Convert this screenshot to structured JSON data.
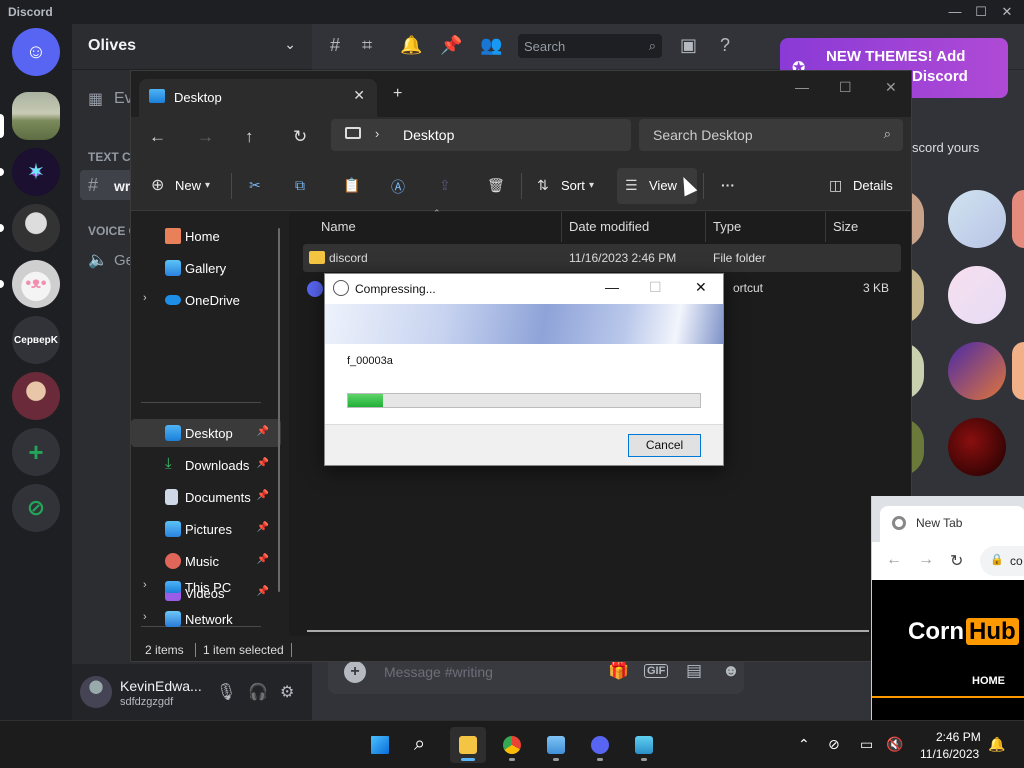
{
  "discord": {
    "app_name": "Discord",
    "server_name": "Olives",
    "guilds": [
      {
        "label": ""
      },
      {
        "label": ""
      },
      {
        "label": ""
      },
      {
        "label": ""
      },
      {
        "label": "CepвepK"
      },
      {
        "label": ""
      }
    ],
    "channels": {
      "events_fragment": "Ev",
      "text_category": "TEXT C",
      "channel_fragment": "wr",
      "voice_category": "VOICE C",
      "voice_fragment": "Ge"
    },
    "user": {
      "name": "KevinEdwa...",
      "status": "sdfdzgzgdf"
    },
    "search_placeholder": "Search",
    "themes_banner": {
      "line1": "NEW THEMES! Add",
      "line2": "Discord"
    },
    "themes_subtext": "scord yours",
    "message_placeholder": "Message #writing"
  },
  "explorer": {
    "tab_title": "Desktop",
    "address": "Desktop",
    "search_placeholder": "Search Desktop",
    "commands": {
      "new": "New",
      "sort": "Sort",
      "view": "View",
      "details": "Details"
    },
    "sidebar": {
      "home": "Home",
      "gallery": "Gallery",
      "onedrive": "OneDrive",
      "desktop": "Desktop",
      "downloads": "Downloads",
      "documents": "Documents",
      "pictures": "Pictures",
      "music": "Music",
      "videos": "Videos",
      "thispc": "This PC",
      "network": "Network"
    },
    "columns": {
      "name": "Name",
      "date": "Date modified",
      "type": "Type",
      "size": "Size"
    },
    "files": [
      {
        "name": "discord",
        "date": "11/16/2023 2:46 PM",
        "type": "File folder",
        "size": ""
      },
      {
        "name": "",
        "date": "",
        "type": "ortcut",
        "size": "3 KB"
      }
    ],
    "status": {
      "items": "2 items",
      "selected": "1 item selected"
    }
  },
  "dialog": {
    "title": "Compressing...",
    "file": "f_00003a",
    "progress": 0.1,
    "cancel": "Cancel"
  },
  "chrome": {
    "tab_title": "New Tab",
    "url_fragment": "co",
    "logo_corn": "Corn",
    "logo_hub": "Hub",
    "nav_home": "HOME"
  },
  "taskbar": {
    "time": "2:46 PM",
    "date": "11/16/2023"
  },
  "colors": {
    "discord_blurple": "#5865f2",
    "discord_green": "#23a559",
    "folder": "#f4c542",
    "progress": "#21b036",
    "hub_orange": "#ff9900"
  }
}
